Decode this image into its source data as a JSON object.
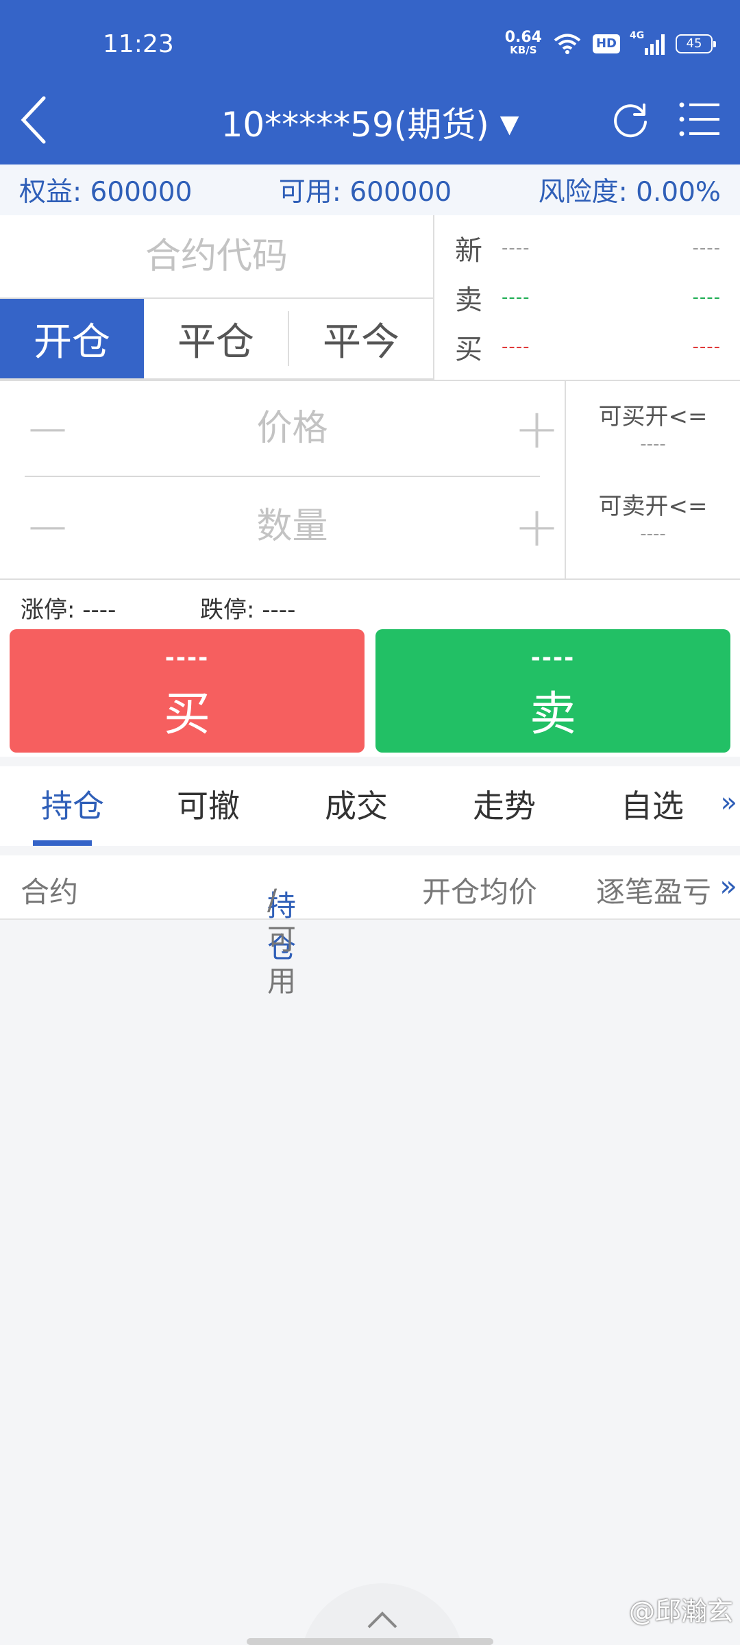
{
  "status_bar": {
    "time": "11:23",
    "speed_value": "0.64",
    "speed_unit": "KB/S",
    "hd": "HD",
    "network": "4G",
    "battery": "45"
  },
  "nav": {
    "title": "10*****59(期货)",
    "back_icon": "back-arrow-icon",
    "refresh_icon": "refresh-icon",
    "menu_icon": "menu-list-icon"
  },
  "account": {
    "equity": "权益: 600000",
    "available": "可用: 600000",
    "risk": "风险度:  0.00%"
  },
  "order": {
    "code_placeholder": "合约代码",
    "mode_tabs": [
      "开仓",
      "平仓",
      "平今"
    ],
    "quote": [
      {
        "label": "新",
        "v1": "----",
        "v2": "----"
      },
      {
        "label": "卖",
        "v1": "----",
        "v2": "----"
      },
      {
        "label": "买",
        "v1": "----",
        "v2": "----"
      }
    ],
    "price_placeholder": "价格",
    "qty_placeholder": "数量",
    "minus": "−",
    "plus": "+",
    "can_buy_open_label": "可买开<=",
    "can_buy_open_value": "----",
    "can_sell_open_label": "可卖开<=",
    "can_sell_open_value": "----",
    "limit_up": "涨停: ----",
    "limit_down": "跌停: ----",
    "buy": {
      "price": "----",
      "label": "买"
    },
    "sell": {
      "price": "----",
      "label": "卖"
    }
  },
  "tabs": {
    "items": [
      "持仓",
      "可撤",
      "成交",
      "走势",
      "自选"
    ],
    "more": "»"
  },
  "positions_header": {
    "contract": "合约",
    "position_hl": "持仓",
    "position_rest": "/可用",
    "avg_price": "开仓均价",
    "pnl": "逐笔盈亏",
    "more": "»"
  },
  "watermark": "@邱瀚玄",
  "colors": {
    "primary": "#3564c8",
    "buy": "#f65f5f",
    "sell": "#22c065",
    "red_text": "#e03a3a",
    "green_text": "#1fae54"
  }
}
